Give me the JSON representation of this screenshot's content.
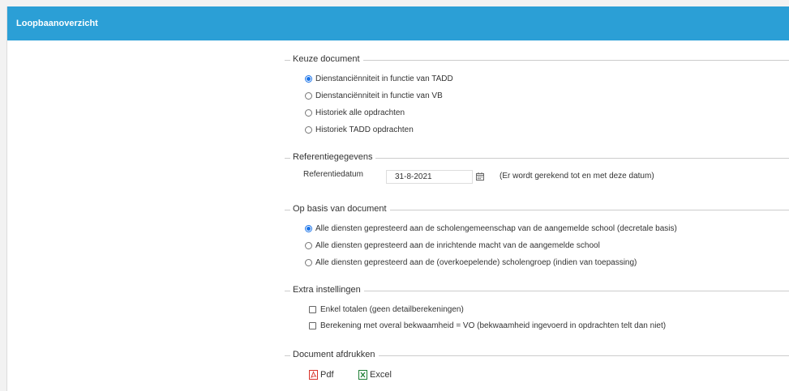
{
  "header": {
    "title": "Loopbaanoverzicht"
  },
  "keuze": {
    "legend": "Keuze document",
    "options": [
      {
        "label": "Dienstanciënniteit in functie van TADD",
        "checked": true
      },
      {
        "label": "Dienstanciënniteit in functie van VB",
        "checked": false
      },
      {
        "label": "Historiek alle opdrachten",
        "checked": false
      },
      {
        "label": "Historiek TADD opdrachten",
        "checked": false
      }
    ]
  },
  "referentie": {
    "legend": "Referentiegegevens",
    "label": "Referentiedatum",
    "value": "31-8-2021",
    "note": "(Er wordt gerekend tot en met deze datum)",
    "icon": "calendar-icon"
  },
  "basis": {
    "legend": "Op basis van document",
    "options": [
      {
        "label": "Alle diensten gepresteerd aan de scholengemeenschap van de aangemelde school (decretale basis)",
        "checked": true
      },
      {
        "label": "Alle diensten gepresteerd aan de inrichtende macht van de aangemelde school",
        "checked": false
      },
      {
        "label": "Alle diensten gepresteerd aan de (overkoepelende) scholengroep (indien van toepassing)",
        "checked": false
      }
    ]
  },
  "extra": {
    "legend": "Extra instellingen",
    "options": [
      {
        "label": "Enkel totalen (geen detailberekeningen)",
        "checked": false
      },
      {
        "label": "Berekening met overal bekwaamheid = VO (bekwaamheid ingevoerd in opdrachten telt dan niet)",
        "checked": false
      }
    ]
  },
  "afdrukken": {
    "legend": "Document afdrukken",
    "pdf_label": "Pdf",
    "excel_label": "Excel",
    "pdf_color": "#d9342b",
    "excel_color": "#1e7e34"
  },
  "colors": {
    "header": "#2b9fd6",
    "radio_checked": "#1a73e8"
  }
}
